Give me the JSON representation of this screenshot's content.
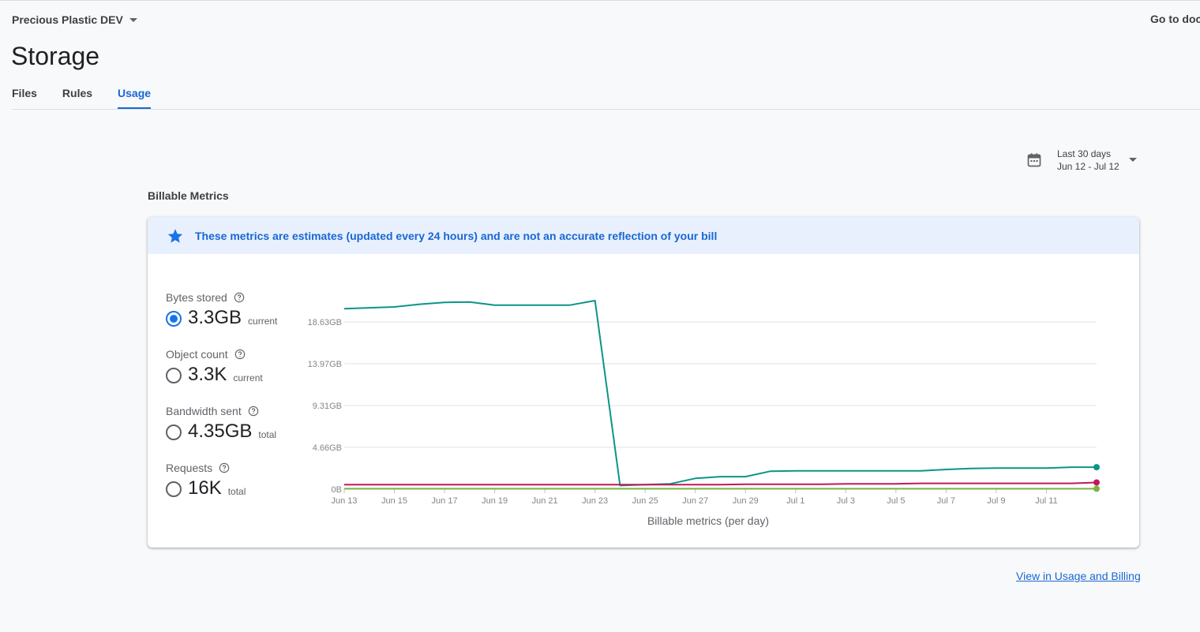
{
  "header": {
    "project_name": "Precious Plastic DEV",
    "docs_link": "Go to docs",
    "page_title": "Storage"
  },
  "tabs": [
    {
      "label": "Files",
      "active": false
    },
    {
      "label": "Rules",
      "active": false
    },
    {
      "label": "Usage",
      "active": true
    }
  ],
  "date_range": {
    "label": "Last 30 days",
    "range": "Jun 12 - Jul 12",
    "icon": "calendar-icon"
  },
  "section_label": "Billable Metrics",
  "notice": {
    "text": "These metrics are estimates (updated every 24 hours) and are not an accurate reflection of your bill",
    "icon": "star-icon"
  },
  "metrics": [
    {
      "label": "Bytes stored",
      "value": "3.3GB",
      "unit": "current",
      "selected": true
    },
    {
      "label": "Object count",
      "value": "3.3K",
      "unit": "current",
      "selected": false
    },
    {
      "label": "Bandwidth sent",
      "value": "4.35GB",
      "unit": "total",
      "selected": false
    },
    {
      "label": "Requests",
      "value": "16K",
      "unit": "total",
      "selected": false
    }
  ],
  "footer_link": "View in Usage and Billing",
  "colors": {
    "accent": "#1a73e8",
    "link": "#1967d2",
    "series_bytes": "#0b9586",
    "series_requests": "#c2185b",
    "series_bandwidth": "#7cb342"
  },
  "chart_data": {
    "type": "line",
    "xlabel": "Billable metrics (per day)",
    "ylabel": "",
    "x_ticks": [
      "Jun 13",
      "Jun 15",
      "Jun 17",
      "Jun 19",
      "Jun 21",
      "Jun 23",
      "Jun 25",
      "Jun 27",
      "Jun 29",
      "Jul 1",
      "Jul 3",
      "Jul 5",
      "Jul 7",
      "Jul 9",
      "Jul 11"
    ],
    "y_ticks": [
      "0B",
      "4.66GB",
      "9.31GB",
      "13.97GB",
      "18.63GB"
    ],
    "y_tick_values": [
      0,
      4.66,
      9.31,
      13.97,
      18.63
    ],
    "ylim": [
      0,
      18.63
    ],
    "grid": true,
    "x": [
      "Jun 13",
      "Jun 14",
      "Jun 15",
      "Jun 16",
      "Jun 17",
      "Jun 18",
      "Jun 19",
      "Jun 20",
      "Jun 21",
      "Jun 22",
      "Jun 23",
      "Jun 24",
      "Jun 25",
      "Jun 26",
      "Jun 27",
      "Jun 28",
      "Jun 29",
      "Jun 30",
      "Jul 1",
      "Jul 2",
      "Jul 3",
      "Jul 4",
      "Jul 5",
      "Jul 6",
      "Jul 7",
      "Jul 8",
      "Jul 9",
      "Jul 10",
      "Jul 11",
      "Jul 12"
    ],
    "series": [
      {
        "color": "#0b9586",
        "values": [
          20.1,
          20.2,
          20.3,
          20.6,
          20.8,
          20.85,
          20.5,
          20.5,
          20.5,
          20.5,
          21.0,
          0.4,
          0.5,
          0.6,
          1.2,
          1.4,
          1.4,
          2.0,
          2.05,
          2.05,
          2.05,
          2.05,
          2.05,
          2.05,
          2.2,
          2.3,
          2.35,
          2.35,
          2.35,
          2.45,
          2.45
        ]
      },
      {
        "color": "#c2185b",
        "values": [
          0.5,
          0.5,
          0.5,
          0.5,
          0.5,
          0.5,
          0.5,
          0.5,
          0.5,
          0.5,
          0.5,
          0.5,
          0.5,
          0.5,
          0.5,
          0.5,
          0.55,
          0.55,
          0.55,
          0.55,
          0.6,
          0.6,
          0.6,
          0.65,
          0.65,
          0.65,
          0.65,
          0.65,
          0.65,
          0.65,
          0.75
        ]
      },
      {
        "color": "#7cb342",
        "values": [
          0.05,
          0.05,
          0.05,
          0.05,
          0.05,
          0.05,
          0.05,
          0.05,
          0.05,
          0.05,
          0.05,
          0.05,
          0.05,
          0.05,
          0.05,
          0.05,
          0.05,
          0.05,
          0.05,
          0.05,
          0.05,
          0.05,
          0.05,
          0.05,
          0.05,
          0.05,
          0.05,
          0.05,
          0.05,
          0.05,
          0.05
        ]
      }
    ]
  }
}
